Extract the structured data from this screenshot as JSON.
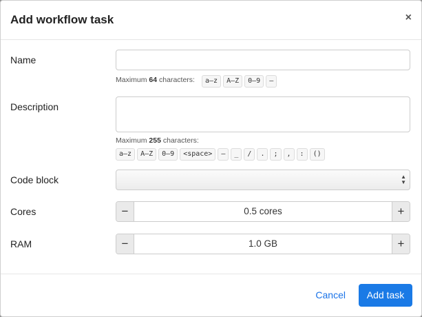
{
  "dialog": {
    "title": "Add workflow task",
    "close_symbol": "×"
  },
  "fields": {
    "name": {
      "label": "Name",
      "value": "",
      "hint_prefix": "Maximum ",
      "hint_count": "64",
      "hint_suffix": " characters:",
      "chips": [
        "a–z",
        "A–Z",
        "0–9",
        "–"
      ]
    },
    "description": {
      "label": "Description",
      "value": "",
      "hint_prefix": "Maximum ",
      "hint_count": "255",
      "hint_suffix": " characters:",
      "chips": [
        "a–z",
        "A–Z",
        "0–9",
        "<space>",
        "–",
        "_",
        "/",
        ".",
        ";",
        ",",
        ":",
        "()"
      ]
    },
    "code_block": {
      "label": "Code block",
      "selected": ""
    },
    "cores": {
      "label": "Cores",
      "value": "0.5 cores",
      "minus": "−",
      "plus": "+"
    },
    "ram": {
      "label": "RAM",
      "value": "1.0 GB",
      "minus": "−",
      "plus": "+"
    }
  },
  "footer": {
    "cancel_label": "Cancel",
    "submit_label": "Add task"
  }
}
